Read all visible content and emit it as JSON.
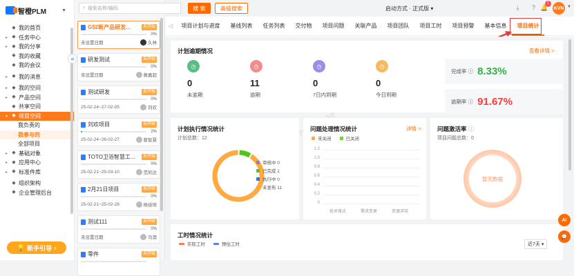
{
  "app": {
    "name": "智橙PLM"
  },
  "sidebar": {
    "items": [
      {
        "label": "我的首页",
        "icon": "home-icon",
        "arrow": ""
      },
      {
        "label": "任务中心",
        "icon": "task-icon",
        "arrow": "▸"
      },
      {
        "label": "我的分享",
        "icon": "share-icon",
        "arrow": "▸"
      },
      {
        "label": "我的收藏",
        "icon": "star-icon",
        "arrow": ""
      },
      {
        "label": "我的会议",
        "icon": "meeting-icon",
        "arrow": ""
      },
      {
        "label": "我的消息",
        "icon": "bell-icon",
        "arrow": "▸"
      },
      {
        "label": "我的空间",
        "icon": "space-icon",
        "arrow": "▸"
      },
      {
        "label": "产品空间",
        "icon": "product-icon",
        "arrow": "▸"
      },
      {
        "label": "共享空间",
        "icon": "shared-space-icon",
        "arrow": ""
      },
      {
        "label": "项目空间",
        "icon": "project-icon",
        "arrow": "▾"
      },
      {
        "label": "我负责的",
        "sub": true
      },
      {
        "label": "我参与的",
        "sub": true
      },
      {
        "label": "全部项目",
        "sub": true
      },
      {
        "label": "基础对象",
        "icon": "object-icon",
        "arrow": "▸"
      },
      {
        "label": "应用中心",
        "icon": "app-icon",
        "arrow": "▸"
      },
      {
        "label": "标准件库",
        "icon": "library-icon",
        "arrow": "▸"
      },
      {
        "label": "组织架构",
        "icon": "org-icon",
        "arrow": ""
      },
      {
        "label": "企业管理后台",
        "icon": "admin-icon",
        "arrow": ""
      }
    ],
    "novice_button": "新手引导"
  },
  "search": {
    "placeholder": "搜索名称/编码",
    "search_button": "搜 索",
    "advanced_button": "高级搜索"
  },
  "topbar": {
    "launch_mode": "启动方式 · 正式版",
    "bell_count": "1",
    "user_initials": "KVN"
  },
  "projects": [
    {
      "name": "G52新产品研发...",
      "status": "未开始",
      "progress": "0%",
      "progress_value": 0,
      "date": "未设置日期",
      "owner": "久林",
      "dark": true
    },
    {
      "name": "研发测试",
      "status": "未开始",
      "progress": "0%",
      "progress_value": 0,
      "date": "未设置日期",
      "owner": "黄嘉超"
    },
    {
      "name": "测试研发",
      "status": "未开始",
      "progress": "0%",
      "progress_value": 0,
      "date": "25-02-24~27-02-05",
      "owner": "刘欢"
    },
    {
      "name": "刘欢项目",
      "status": "未开始",
      "progress": "2%",
      "progress_value": 2,
      "date": "25-02-24~26-02-27",
      "owner": "蔡智慧"
    },
    {
      "name": "TOTO卫浴智慧工...",
      "status": "未开始",
      "progress": "0%",
      "progress_value": 0,
      "date": "25-02-21~25-03-10",
      "owner": "范凯达"
    },
    {
      "name": "2月21日项目",
      "status": "未开始",
      "progress": "0%",
      "progress_value": 0,
      "date": "25-02-21~25-02-28",
      "owner": "杨佳琦"
    },
    {
      "name": "测试111",
      "status": "未开始",
      "progress": "0%",
      "progress_value": 0,
      "date": "未设置日期",
      "owner": "马澳"
    },
    {
      "name": "零件",
      "status": "未开始",
      "progress": "",
      "progress_value": 0,
      "date": "",
      "owner": ""
    }
  ],
  "tabs": [
    "项目计划与进度",
    "基线列表",
    "任务列表",
    "交付物",
    "项目问题",
    "关联产品",
    "项目团队",
    "项目工时",
    "项目预警",
    "基本信息",
    "项目统计"
  ],
  "overdue": {
    "title": "计划逾期情况",
    "detail_link": "查看详情 >",
    "stats": [
      {
        "value": "0",
        "label": "未逾期",
        "color": "#3cb371"
      },
      {
        "value": "11",
        "label": "逾期",
        "color": "#f27a7a"
      },
      {
        "value": "0",
        "label": "7日内到期",
        "color": "#8c7ae6"
      },
      {
        "value": "0",
        "label": "今日到期",
        "color": "#f5b041"
      }
    ],
    "completion_label": "完成率",
    "completion_value": "8.33%",
    "overdue_label": "逾期率",
    "overdue_value": "91.67%"
  },
  "plan_exec": {
    "title": "计划执行情况统计",
    "total": "计划总数：12",
    "legend": [
      {
        "label": "审核中 0",
        "color": "#8c7ae6",
        "value": 0
      },
      {
        "label": "已完成 1",
        "color": "#52c41a",
        "value": 1
      },
      {
        "label": "执行中 0",
        "color": "#1677ff",
        "value": 0
      },
      {
        "label": "未发布 11",
        "color": "#ffa940",
        "value": 11
      }
    ]
  },
  "issues": {
    "title": "问题处理情况统计",
    "detail_link": "详情 >",
    "legend": [
      {
        "label": "未关闭",
        "color": "#ffa940"
      },
      {
        "label": "已关闭",
        "color": "#73d13d"
      }
    ],
    "yticks": [
      "1.2",
      "1.0",
      "0.8",
      "0.6",
      "0.4",
      "0.2",
      "0"
    ],
    "categories": [
      "技术难点",
      "需求变更",
      "资源冲突"
    ]
  },
  "activation": {
    "title": "问题激活率",
    "total": "项目问题总数：0",
    "empty": "暂无数据"
  },
  "worktime": {
    "title": "工时情况统计",
    "legend": [
      {
        "label": "实际工时",
        "color": "#ff7a45"
      },
      {
        "label": "预估工时",
        "color": "#597ef7"
      }
    ],
    "range": "近7天"
  },
  "watermark": "Uniorange",
  "float": {
    "ai": "AI"
  }
}
